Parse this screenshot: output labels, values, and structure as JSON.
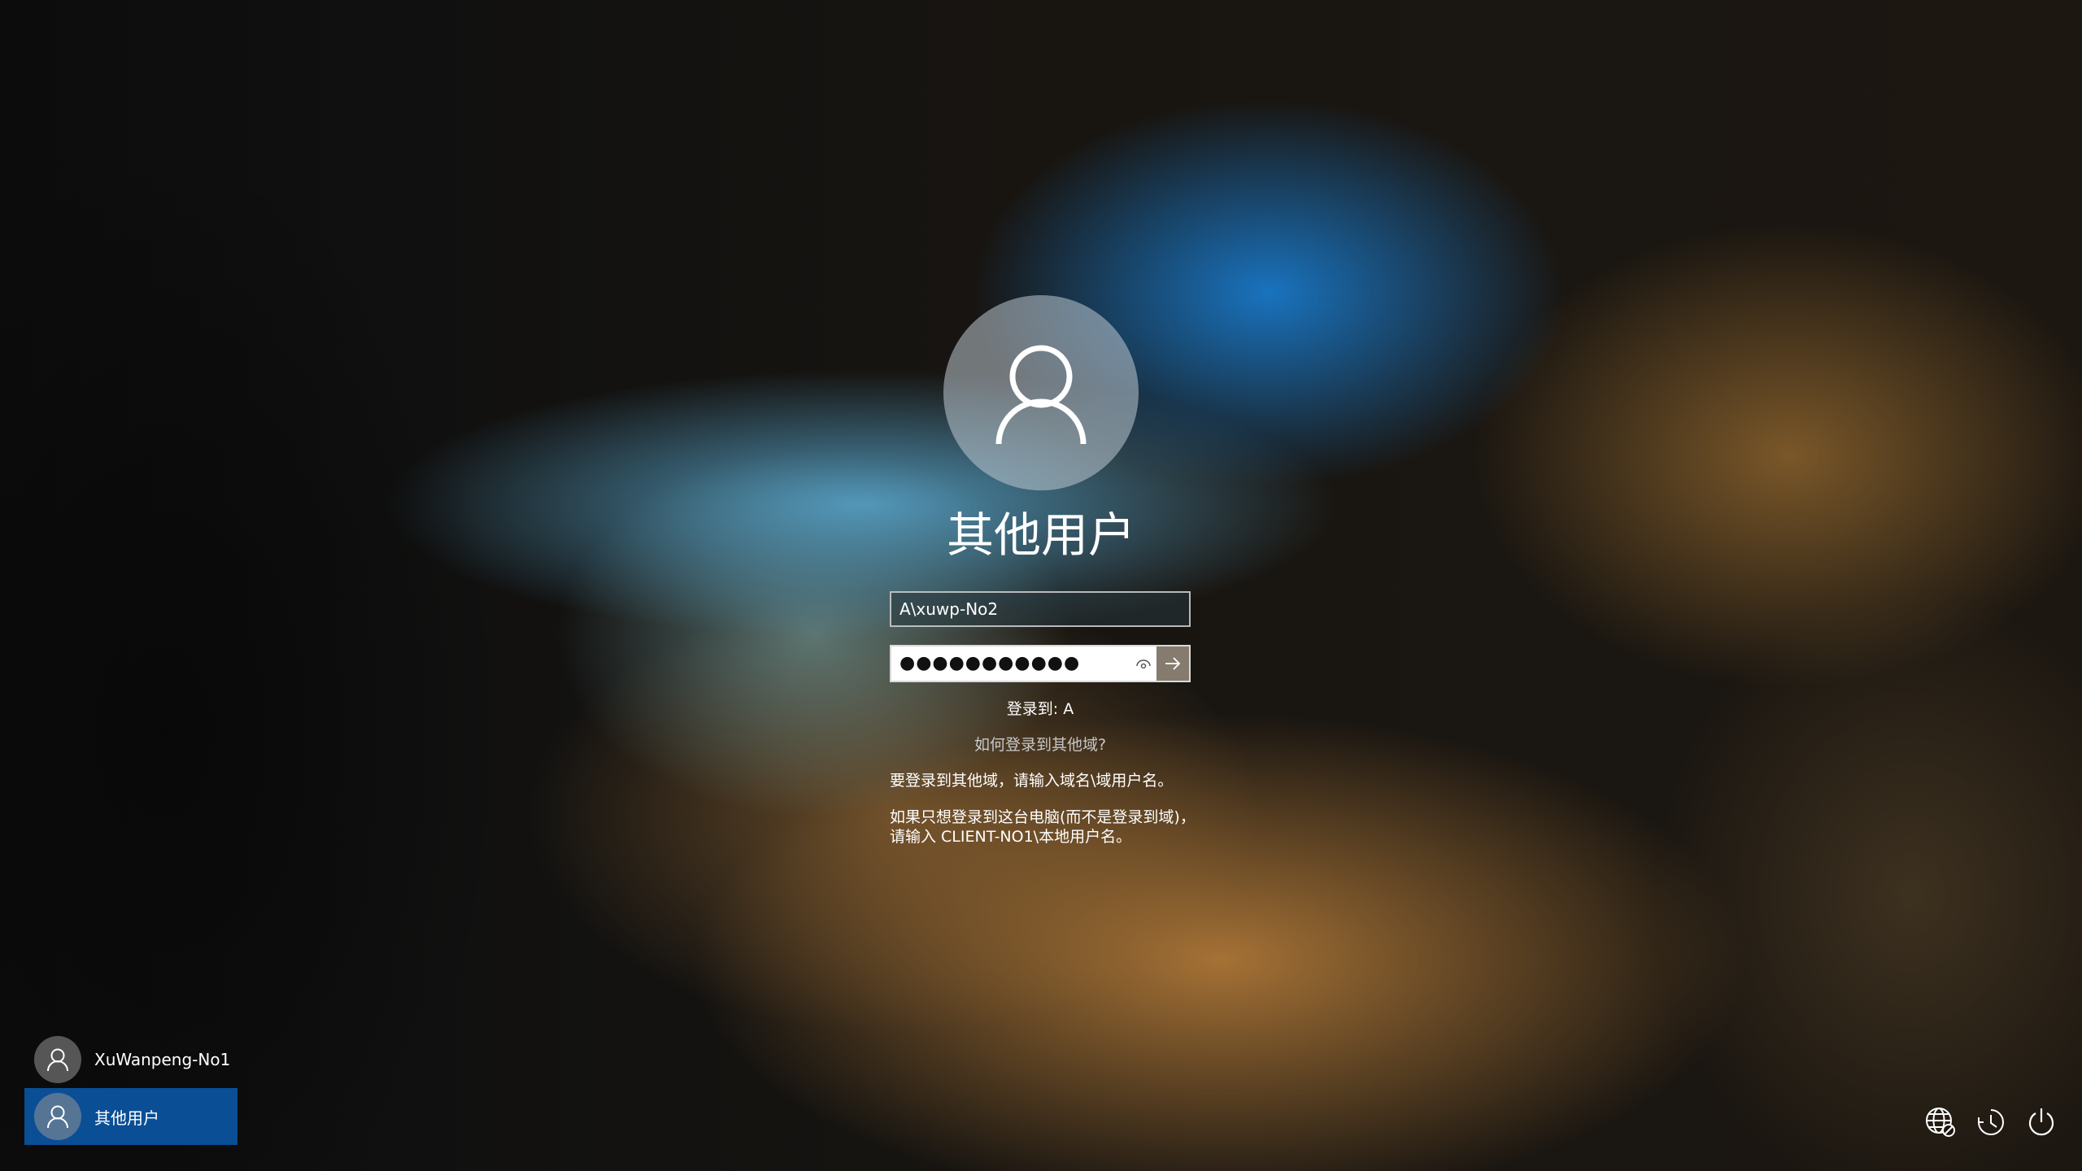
{
  "login": {
    "title": "其他用户",
    "username_value": "A\\xuwp-No2",
    "password_masked": "●●●●●●●●●●●",
    "signin_to": "登录到: A",
    "help_link": "如何登录到其他域?",
    "hint_domain": "要登录到其他域，请输入域名\\域用户名。",
    "hint_local_line1": "如果只想登录到这台电脑(而不是登录到域)，",
    "hint_local_line2": "请输入 CLIENT-NO1\\本地用户名。"
  },
  "users": [
    {
      "name": "XuWanpeng-No1",
      "selected": false
    },
    {
      "name": "其他用户",
      "selected": true
    }
  ],
  "icons": {
    "avatar": "user-icon",
    "reveal": "eye-icon",
    "submit": "arrow-right-icon",
    "network": "network-globe-icon",
    "accessibility": "accessibility-icon",
    "power": "power-icon"
  },
  "colors": {
    "selected_user_bg": "#0a4e96"
  }
}
